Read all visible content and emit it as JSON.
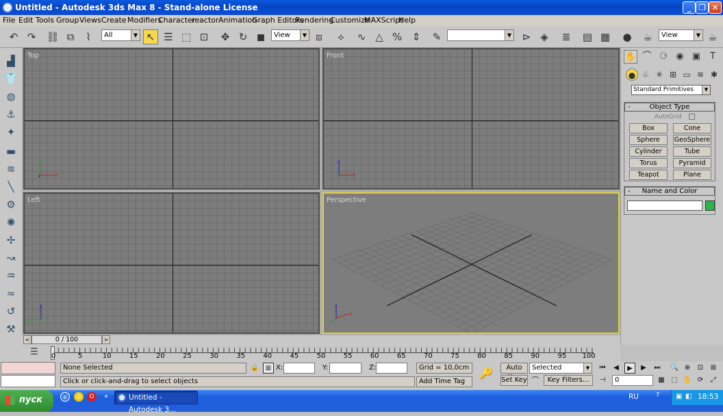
{
  "window": {
    "title": "Untitled - Autodesk 3ds Max 8  - Stand-alone License",
    "min": "_",
    "max": "❐",
    "close": "✕"
  },
  "menu": [
    "File",
    "Edit",
    "Tools",
    "Group",
    "Views",
    "Create",
    "Modifiers",
    "Character",
    "reactor",
    "Animation",
    "Graph Editors",
    "Rendering",
    "Customize",
    "MAXScript",
    "Help"
  ],
  "toolbar": {
    "selection_filter": "All",
    "ref_coord": "View",
    "named_selection": "",
    "render_view": "View"
  },
  "viewports": {
    "top": "Top",
    "front": "Front",
    "left": "Left",
    "perspective": "Perspective"
  },
  "command_panel": {
    "category_dropdown": "Standard Primitives",
    "object_type": {
      "title": "Object Type",
      "autogrid": "AutoGrid",
      "buttons": [
        "Box",
        "Cone",
        "Sphere",
        "GeoSphere",
        "Cylinder",
        "Tube",
        "Torus",
        "Pyramid",
        "Teapot",
        "Plane"
      ]
    },
    "name_color": {
      "title": "Name and Color",
      "name": "",
      "color": "#2ab44a"
    }
  },
  "time_slider": {
    "position": "0 / 100",
    "left": "<",
    "right": ">"
  },
  "track": {
    "labels": [
      "0",
      "5",
      "10",
      "15",
      "20",
      "25",
      "30",
      "35",
      "40",
      "45",
      "50",
      "55",
      "60",
      "65",
      "70",
      "75",
      "80",
      "85",
      "90",
      "95",
      "100"
    ]
  },
  "status": {
    "selection": "None Selected",
    "prompt": "Click or click-and-drag to select objects",
    "x_label": "X:",
    "y_label": "Y:",
    "z_label": "Z:",
    "x": "",
    "y": "",
    "z": "",
    "grid": "Grid = 10,0cm",
    "add_time_tag": "Add Time Tag",
    "auto_key": "Auto Key",
    "set_key": "Set Key",
    "key_mode": "Selected",
    "key_filters": "Key Filters...",
    "frame": "0"
  },
  "taskbar": {
    "start": "пуск",
    "task": "Untitled - Autodesk 3...",
    "lang": "RU",
    "time": "18:53"
  }
}
